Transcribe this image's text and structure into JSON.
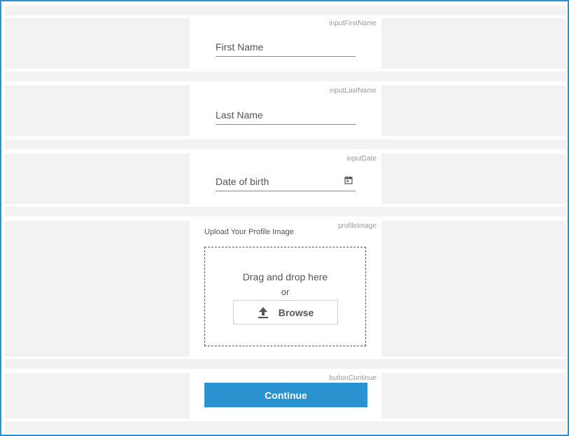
{
  "form": {
    "first_name": {
      "tag": "inputFirstName",
      "placeholder": "First Name"
    },
    "last_name": {
      "tag": "inputLastName",
      "placeholder": "Last Name"
    },
    "date": {
      "tag": "inputDate",
      "placeholder": "Date of birth",
      "icon": "calendar-icon"
    },
    "profile_image": {
      "tag": "profileImage",
      "title": "Upload Your Profile Image",
      "drag_text": "Drag and drop here",
      "or_text": "or",
      "browse_label": "Browse",
      "icon": "upload-icon"
    },
    "continue": {
      "tag": "buttonContinue",
      "label": "Continue"
    }
  },
  "colors": {
    "accent": "#2a93cf",
    "panel": "#f2f2f2"
  }
}
